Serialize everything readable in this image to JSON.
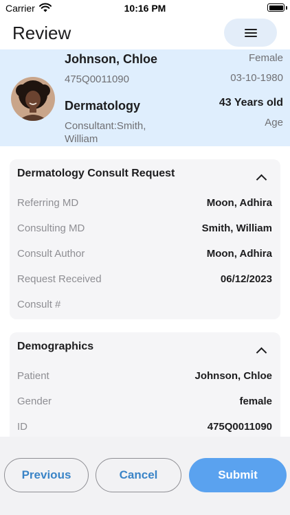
{
  "status_bar": {
    "carrier": "Carrier",
    "time": "10:16 PM"
  },
  "nav": {
    "title": "Review"
  },
  "patient": {
    "name": "Johnson, Chloe",
    "mrn": "475Q0011090",
    "department": "Dermatology",
    "consultant": "Consultant:Smith, William",
    "gender": "Female",
    "dob": "03-10-1980",
    "age": "43 Years old",
    "age_label": "Age"
  },
  "consult_card": {
    "title": "Dermatology Consult Request",
    "rows": [
      {
        "label": "Referring MD",
        "value": "Moon, Adhira"
      },
      {
        "label": "Consulting MD",
        "value": "Smith, William"
      },
      {
        "label": "Consult Author",
        "value": "Moon, Adhira"
      },
      {
        "label": "Request Received",
        "value": "06/12/2023"
      },
      {
        "label": "Consult #",
        "value": ""
      }
    ]
  },
  "demographics_card": {
    "title": "Demographics",
    "rows": [
      {
        "label": "Patient",
        "value": "Johnson, Chloe"
      },
      {
        "label": "Gender",
        "value": "female"
      },
      {
        "label": "ID",
        "value": "475Q0011090"
      }
    ]
  },
  "footer": {
    "previous_label": "Previous",
    "cancel_label": "Cancel",
    "submit_label": "Submit"
  },
  "colors": {
    "banner_bg": "#dfeefd",
    "accent": "#3a84c7",
    "submit_bg": "#5aa2ef",
    "card_bg": "#f5f5f7"
  }
}
